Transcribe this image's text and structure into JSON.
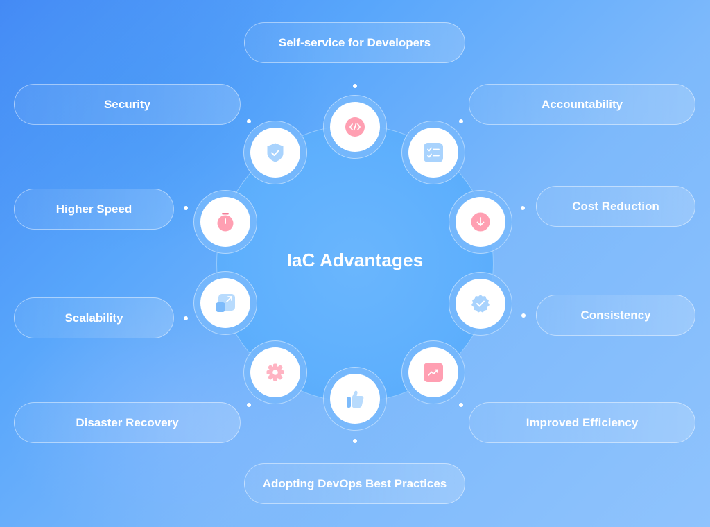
{
  "title": "IaC Advantages",
  "colors": {
    "accent_pink": "#ff9fb2",
    "accent_blue": "#a9d3fd",
    "node_white": "#ffffff",
    "text": "#ffffff"
  },
  "advantages": [
    {
      "label": "Self-service for Developers",
      "icon": "code-icon",
      "icon_color": "pink"
    },
    {
      "label": "Accountability",
      "icon": "checklist-icon",
      "icon_color": "blue"
    },
    {
      "label": "Cost Reduction",
      "icon": "arrow-down-circle-icon",
      "icon_color": "pink"
    },
    {
      "label": "Consistency",
      "icon": "verified-badge-icon",
      "icon_color": "blue"
    },
    {
      "label": "Improved Efficiency",
      "icon": "trending-up-icon",
      "icon_color": "pink"
    },
    {
      "label": "Adopting DevOps Best Practices",
      "icon": "thumbs-up-icon",
      "icon_color": "blue"
    },
    {
      "label": "Disaster Recovery",
      "icon": "gear-icon",
      "icon_color": "pink"
    },
    {
      "label": "Scalability",
      "icon": "scale-up-icon",
      "icon_color": "blue"
    },
    {
      "label": "Higher Speed",
      "icon": "stopwatch-icon",
      "icon_color": "pink"
    },
    {
      "label": "Security",
      "icon": "shield-check-icon",
      "icon_color": "blue"
    }
  ]
}
